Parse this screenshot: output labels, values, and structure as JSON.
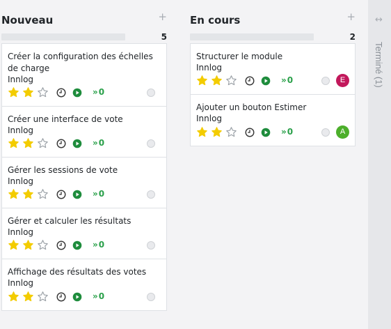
{
  "columns": [
    {
      "title": "Nouveau",
      "add_icon": "plus-icon",
      "count": "5",
      "cards": [
        {
          "title": "Créer la configuration des échelles de charge",
          "project": "Innlog",
          "rating": 2,
          "rating_max": 3,
          "counter": "0",
          "avatar": null
        },
        {
          "title": "Créer une interface de vote",
          "project": "Innlog",
          "rating": 2,
          "rating_max": 3,
          "counter": "0",
          "avatar": null
        },
        {
          "title": "Gérer les sessions de vote",
          "project": "Innlog",
          "rating": 2,
          "rating_max": 3,
          "counter": "0",
          "avatar": null
        },
        {
          "title": "Gérer et calculer les résultats",
          "project": "Innlog",
          "rating": 2,
          "rating_max": 3,
          "counter": "0",
          "avatar": null
        },
        {
          "title": "Affichage des résultats des votes",
          "project": "Innlog",
          "rating": 2,
          "rating_max": 3,
          "counter": "0",
          "avatar": null
        }
      ]
    },
    {
      "title": "En cours",
      "add_icon": "plus-icon",
      "count": "2",
      "cards": [
        {
          "title": "Structurer le module",
          "project": "Innlog",
          "rating": 2,
          "rating_max": 3,
          "counter": "0",
          "avatar": {
            "letter": "E",
            "color": "#c2185b"
          }
        },
        {
          "title": "Ajouter un bouton Estimer",
          "project": "Innlog",
          "rating": 2,
          "rating_max": 3,
          "counter": "0",
          "avatar": {
            "letter": "A",
            "color": "#4caf2b"
          }
        }
      ]
    }
  ],
  "collapsed_column": {
    "label": "Terminé (1)",
    "expand_icon": "expand-horizontal-icon"
  },
  "icons": {
    "clock": "clock-icon",
    "play": "play-circle-icon",
    "chevrons": "double-chevron-right-icon"
  },
  "colors": {
    "star_filled": "#f3cc00",
    "star_empty": "#9aa0a6",
    "play": "#1e8c3c",
    "counter": "#2aa04a"
  }
}
